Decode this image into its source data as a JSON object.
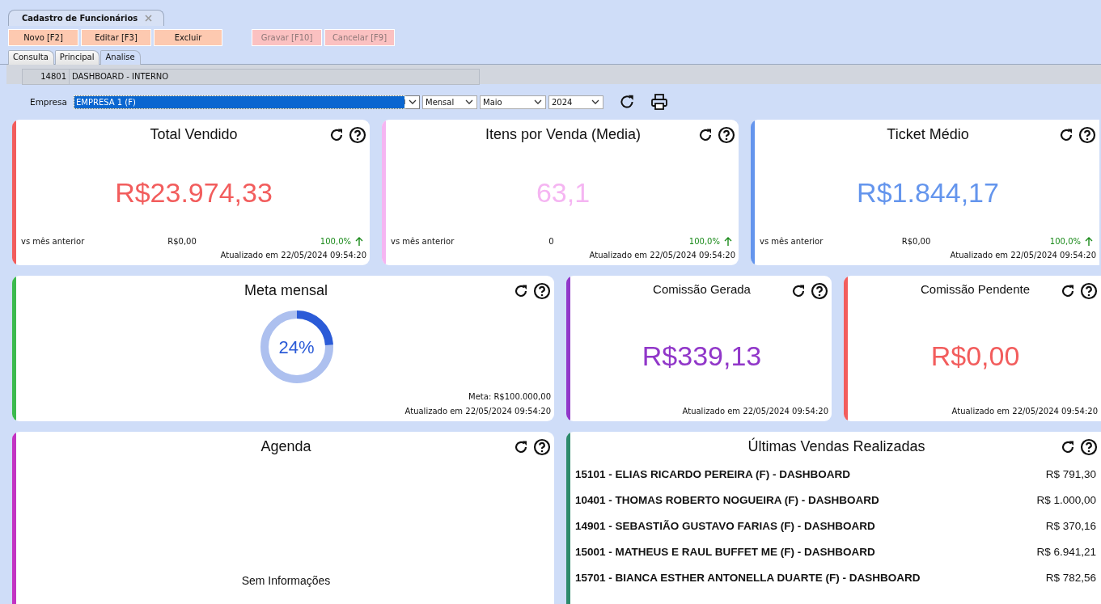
{
  "document_tab": {
    "title": "Cadastro de Funcionários"
  },
  "toolbar": [
    {
      "label": "Novo [F2]",
      "disabled": false
    },
    {
      "label": "Editar [F3]",
      "disabled": false
    },
    {
      "label": "Excluir",
      "disabled": false
    },
    {
      "label": "Gravar [F10]",
      "disabled": true
    },
    {
      "label": "Cancelar [F9]",
      "disabled": true
    }
  ],
  "tabs": [
    {
      "label": "Consulta",
      "selected": false
    },
    {
      "label": "Principal",
      "selected": false
    },
    {
      "label": "Analise",
      "selected": true
    }
  ],
  "record": {
    "code": "14801",
    "name": "DASHBOARD - INTERNO"
  },
  "filters": {
    "empresa_label": "Empresa",
    "empresa": "EMPRESA 1 (F)",
    "period": "Mensal",
    "month": "Maio",
    "year": "2024"
  },
  "kpi_cards": [
    {
      "title": "Total Vendido",
      "value": "R$23.974,33",
      "color": "#f25d5d",
      "comparison_label": "vs mês anterior",
      "previous": "R$0,00",
      "change": "100,0%",
      "updated": "Atualizado em 22/05/2024 09:54:20"
    },
    {
      "title": "Itens por Venda (Media)",
      "value": "63,1",
      "color": "#f5b5f2",
      "comparison_label": "vs mês anterior",
      "previous": "0",
      "change": "100,0%",
      "updated": "Atualizado em 22/05/2024 09:54:20"
    },
    {
      "title": "Ticket Médio",
      "value": "R$1.844,17",
      "color": "#6495ed",
      "comparison_label": "vs mês anterior",
      "previous": "R$0,00",
      "change": "100,0%",
      "updated": "Atualizado em 22/05/2024 09:54:20"
    }
  ],
  "goal_card": {
    "title": "Meta mensal",
    "percent": "24%",
    "level": 0.24,
    "color": "#3cba4e",
    "goal": "Meta: R$100.000,00",
    "updated": "Atualizado em 22/05/2024 09:54:20"
  },
  "commission_cards": [
    {
      "title": "Comissão Gerada",
      "value": "R$339,13",
      "color": "#9137c9",
      "updated": "Atualizado em 22/05/2024 09:54:20"
    },
    {
      "title": "Comissão Pendente",
      "value": "R$0,00",
      "color": "#f25d5d",
      "updated": "Atualizado em 22/05/2024 09:54:20"
    }
  ],
  "agenda_card": {
    "title": "Agenda",
    "color": "#c334c3",
    "empty": "Sem Informações"
  },
  "sales_card": {
    "title": "Últimas Vendas Realizadas",
    "color": "#2e8a6c",
    "rows": [
      {
        "description": "15101 - ELIAS RICARDO PEREIRA (F) - DASHBOARD",
        "amount": "R$ 791,30"
      },
      {
        "description": "10401 - THOMAS ROBERTO NOGUEIRA (F) - DASHBOARD",
        "amount": "R$ 1.000,00"
      },
      {
        "description": "14901 - SEBASTIÃO GUSTAVO FARIAS (F) - DASHBOARD",
        "amount": "R$ 370,16"
      },
      {
        "description": "15001 - MATHEUS E RAUL BUFFET ME (F) - DASHBOARD",
        "amount": "R$ 6.941,21"
      },
      {
        "description": "15701 - BIANCA ESTHER ANTONELLA DUARTE (F) - DASHBOARD",
        "amount": "R$ 782,56"
      }
    ]
  }
}
